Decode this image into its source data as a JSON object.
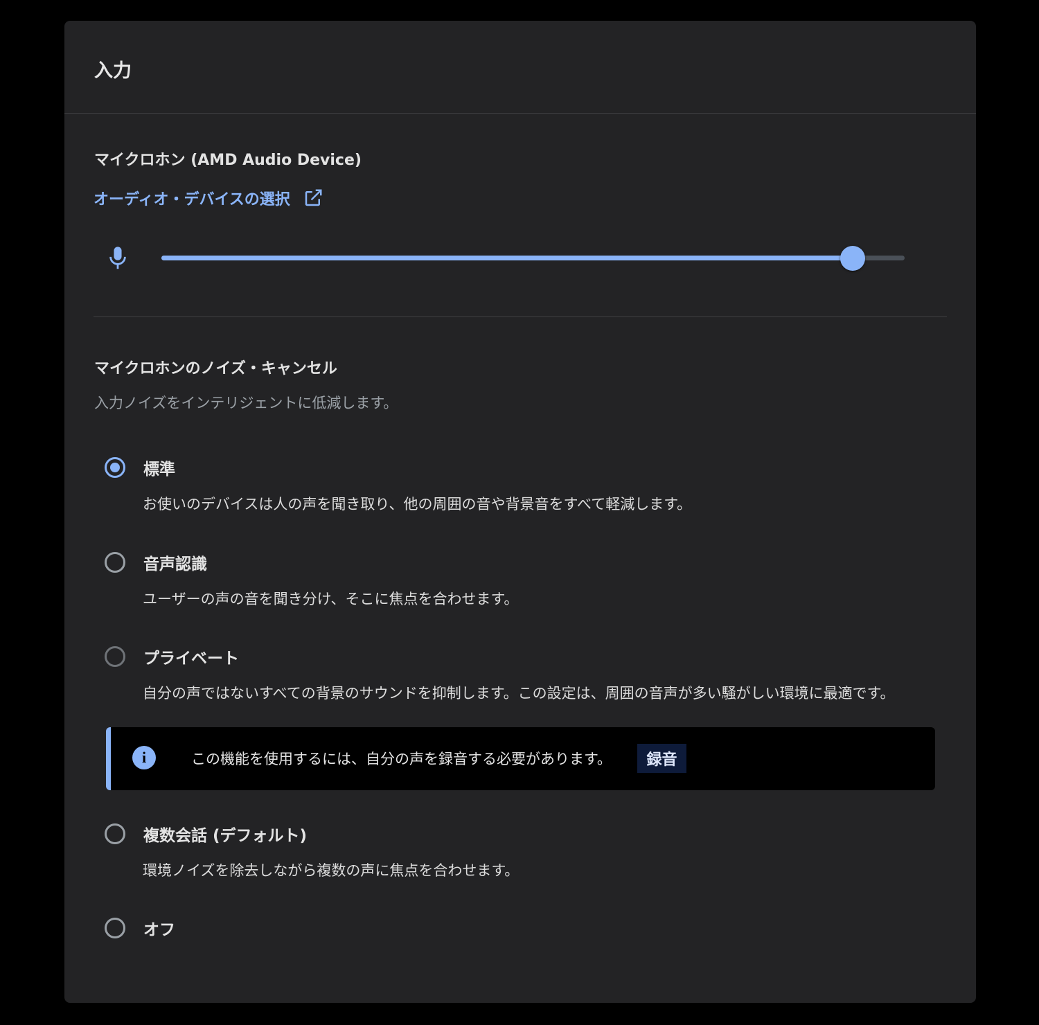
{
  "panel": {
    "title": "入力"
  },
  "microphone": {
    "device_label": "マイクロホン (AMD Audio Device)",
    "select_device_link": "オーディオ・デバイスの選択",
    "volume_fraction": 0.93
  },
  "noise_cancel": {
    "title": "マイクロホンのノイズ・キャンセル",
    "description": "入力ノイズをインテリジェントに低減します。",
    "options": [
      {
        "label": "標準",
        "description": "お使いのデバイスは人の声を聞き取り、他の周囲の音や背景音をすべて軽減します。",
        "selected": true
      },
      {
        "label": "音声認識",
        "description": "ユーザーの声の音を聞き分け、そこに焦点を合わせます。",
        "selected": false
      },
      {
        "label": "プライベート",
        "description": "自分の声ではないすべての背景のサウンドを抑制します。この設定は、周囲の音声が多い騒がしい環境に最適です。",
        "selected": false
      },
      {
        "label": "複数会話 (デフォルト)",
        "description": "環境ノイズを除去しながら複数の声に焦点を合わせます。",
        "selected": false
      },
      {
        "label": "オフ",
        "description": "",
        "selected": false
      }
    ],
    "notice": {
      "text": "この機能を使用するには、自分の声を録音する必要があります。",
      "button_label": "録音"
    }
  },
  "colors": {
    "accent": "#8ab4f8",
    "panel_bg": "#232325",
    "page_bg": "#000000"
  }
}
